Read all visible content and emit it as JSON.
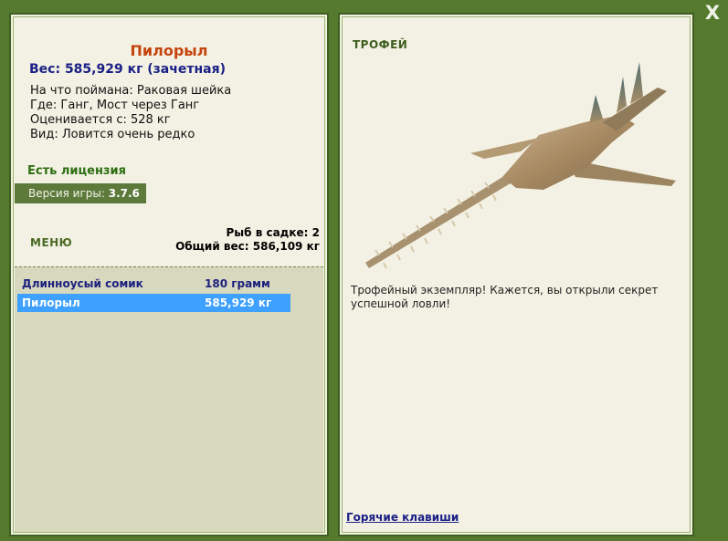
{
  "window": {
    "close_label": "X"
  },
  "fish_info": {
    "name": "Пилорыл",
    "weight_line": "Вес: 585,929 кг (зачетная)",
    "caught_with": "На что поймана: Раковая шейка",
    "location": "Где: Ганг, Мост через Ганг",
    "valued_from": "Оценивается с: 528 кг",
    "rarity": "Вид: Ловится очень редко"
  },
  "license_text": "Есть лицензия",
  "version": {
    "label": "Версия игры: ",
    "value": "3.7.6"
  },
  "menu_label": "МЕНЮ",
  "cage": {
    "count_line": "Рыб в садке: 2",
    "total_line": "Общий вес: 586,109 кг"
  },
  "catch_list": [
    {
      "name": "Длинноусый сомик",
      "weight": "180 грамм"
    },
    {
      "name": "Пилорыл",
      "weight": "585,929 кг"
    }
  ],
  "trophy": {
    "label": "ТРОФЕЙ",
    "image_icon": "sawfish-image",
    "description": "Трофейный экземпляр! Кажется, вы открыли секрет успешной ловли!"
  },
  "hotkeys_label": "Горячие клавиши",
  "colors": {
    "background": "#557a2e",
    "panel": "#f3f1e3",
    "title": "#c6440e",
    "weight": "#1a1f86",
    "license": "#2d6e12",
    "selected_row": "#3ea0ff"
  }
}
